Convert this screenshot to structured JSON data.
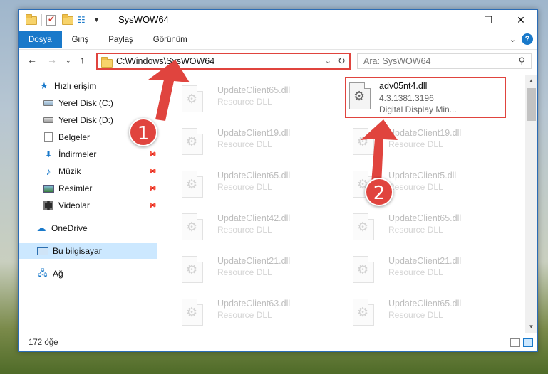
{
  "window": {
    "title": "SysWOW64",
    "controls": [
      "minimize-icon",
      "maximize-icon",
      "close-icon"
    ]
  },
  "ribbon": {
    "tabs": [
      {
        "label": "Dosya",
        "active": true
      },
      {
        "label": "Giriş"
      },
      {
        "label": "Paylaş"
      },
      {
        "label": "Görünüm"
      }
    ]
  },
  "navigation": {
    "address": "C:\\Windows\\SysWOW64",
    "search_placeholder": "Ara: SysWOW64"
  },
  "sidebar": {
    "items": [
      {
        "label": "Hızlı erişim",
        "icon": "star-icon"
      },
      {
        "label": "Yerel Disk (C:)",
        "icon": "drive-icon",
        "pinned": true
      },
      {
        "label": "Yerel Disk (D:)",
        "icon": "drive-icon",
        "pinned": true
      },
      {
        "label": "Belgeler",
        "icon": "document-icon",
        "pinned": true
      },
      {
        "label": "İndirmeler",
        "icon": "download-icon",
        "pinned": true
      },
      {
        "label": "Müzik",
        "icon": "music-icon",
        "pinned": true
      },
      {
        "label": "Resimler",
        "icon": "pictures-icon",
        "pinned": true
      },
      {
        "label": "Videolar",
        "icon": "videos-icon",
        "pinned": true
      },
      {
        "label": "OneDrive",
        "icon": "cloud-icon"
      },
      {
        "label": "Bu bilgisayar",
        "icon": "computer-icon",
        "selected": true
      },
      {
        "label": "Ağ",
        "icon": "network-icon"
      }
    ]
  },
  "files": [
    {
      "name": "UpdateClient65.dll",
      "desc": "Resource DLL",
      "faded": true
    },
    {
      "name": "adv05nt4.dll",
      "desc": "4.3.1381.3196",
      "desc2": "Digital Display Min...",
      "highlight": true
    },
    {
      "name": "UpdateClient19.dll",
      "desc": "Resource DLL",
      "faded": true
    },
    {
      "name": "UpdateClient19.dll",
      "desc": "Resource DLL",
      "faded": true
    },
    {
      "name": "UpdateClient65.dll",
      "desc": "Resource DLL",
      "faded": true
    },
    {
      "name": "UpdateClient5.dll",
      "desc": "Resource DLL",
      "faded": true
    },
    {
      "name": "UpdateClient42.dll",
      "desc": "Resource DLL",
      "faded": true
    },
    {
      "name": "UpdateClient65.dll",
      "desc": "Resource DLL",
      "faded": true
    },
    {
      "name": "UpdateClient21.dll",
      "desc": "Resource DLL",
      "faded": true
    },
    {
      "name": "UpdateClient21.dll",
      "desc": "Resource DLL",
      "faded": true
    },
    {
      "name": "UpdateClient63.dll",
      "desc": "Resource DLL",
      "faded": true
    },
    {
      "name": "UpdateClient65.dll",
      "desc": "Resource DLL",
      "faded": true
    }
  ],
  "status": {
    "count": "172 öğe"
  },
  "annotations": {
    "badge1": "1",
    "badge2": "2",
    "color": "#e0443e"
  }
}
